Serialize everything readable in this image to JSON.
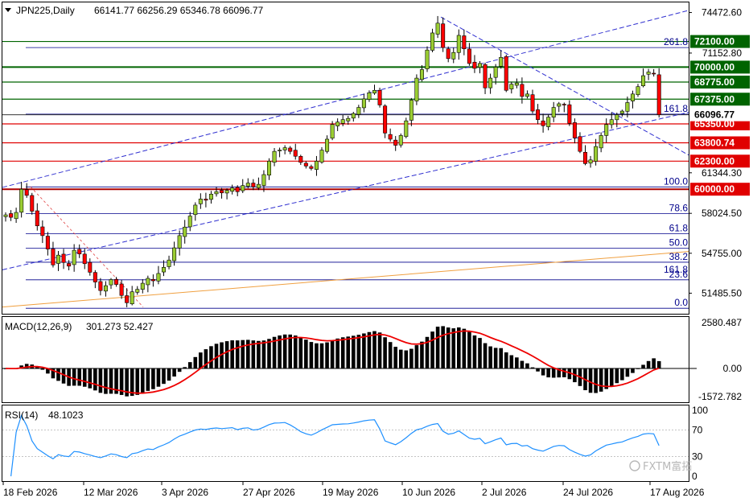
{
  "header": {
    "symbol": "JPN225,Daily",
    "ohlc": "66141.77 66256.29 65346.78 66096.77"
  },
  "watermark": "FXTM富拓",
  "chart_data": [
    {
      "type": "candlestick",
      "title": "JPN225,Daily",
      "ohlc_last": {
        "open": 66141.77,
        "high": 66256.29,
        "low": 65346.78,
        "close": 66096.77
      },
      "y_ticks": [
        "74472.60",
        "71152.80",
        "61344.30",
        "58024.50",
        "54755.00",
        "51485.50"
      ],
      "x_ticks": [
        "18 Feb 2026",
        "12 Mar 2026",
        "3 Apr 2026",
        "27 Apr 2026",
        "19 May 2026",
        "10 Jun 2026",
        "2 Jul 2026",
        "24 Jul 2026",
        "17 Aug 2026"
      ],
      "ylim": [
        49800,
        75300
      ],
      "price_levels_green": [
        72100.0,
        70000.0,
        68775.0,
        67375.0
      ],
      "price_levels_red": [
        65350.0,
        63800.74,
        62300.0,
        60000.0
      ],
      "current_price": 66096.77,
      "green_labels": [
        "72100.00",
        "70000.00",
        "68775.00",
        "67375.00"
      ],
      "red_labels": [
        "65350.00",
        "63800.74",
        "62300.00",
        "60000.00"
      ],
      "current_label": "66096.77",
      "fibonacci": [
        {
          "label": "0.0",
          "level": 50250
        },
        {
          "label": "23.6",
          "level": 52580
        },
        {
          "label": "38.2",
          "level": 54020
        },
        {
          "label": "50.0",
          "level": 55180
        },
        {
          "label": "61.8",
          "level": 56350
        },
        {
          "label": "78.6",
          "level": 58010
        },
        {
          "label": "100.0",
          "level": 60190
        },
        {
          "label": "161.8",
          "level": 66150
        },
        {
          "label": "261.8",
          "level": 71600
        }
      ],
      "fib_extra_label": "161.8",
      "candles_close": [
        57900,
        57700,
        58100,
        60000,
        59500,
        58200,
        57000,
        56200,
        55100,
        53800,
        54600,
        54000,
        53700,
        55000,
        54700,
        53900,
        53200,
        52400,
        51700,
        52100,
        52600,
        52200,
        51300,
        50700,
        51600,
        51800,
        52300,
        52700,
        52500,
        53100,
        53600,
        54200,
        55200,
        56200,
        56900,
        57800,
        58700,
        59200,
        59100,
        59600,
        59800,
        59700,
        59900,
        60100,
        59800,
        60300,
        60500,
        60200,
        60400,
        61200,
        62300,
        63100,
        63200,
        63400,
        63100,
        62700,
        62200,
        61900,
        61700,
        62300,
        63200,
        64100,
        65300,
        65500,
        65700,
        65800,
        66200,
        66700,
        67400,
        67900,
        68100,
        66900,
        64600,
        64100,
        63600,
        64400,
        65600,
        67300,
        69100,
        69800,
        71400,
        72800,
        73600,
        71600,
        70700,
        71200,
        72600,
        71500,
        70300,
        69900,
        70300,
        68300,
        69100,
        70000,
        70800,
        68100,
        68600,
        68700,
        67600,
        67800,
        66400,
        65700,
        65200,
        65900,
        66700,
        67000,
        66900,
        65400,
        64200,
        63100,
        62100,
        62400,
        63500,
        64400,
        65300,
        65700,
        66100,
        66400,
        67100,
        67800,
        68400,
        69300,
        69600,
        69500,
        66100
      ],
      "macd": {
        "label": "MACD(12,26,9)",
        "values": "301.273 52.427",
        "y_ticks": [
          "2580.487",
          "0.00",
          "-1572.782"
        ],
        "ylim": [
          -1900,
          2900
        ]
      },
      "rsi": {
        "label": "RSI(14)",
        "value": "48.1023",
        "y_ticks": [
          "100",
          "70",
          "30",
          "0"
        ],
        "levels": [
          70,
          30
        ],
        "ylim": [
          0,
          100
        ]
      }
    }
  ]
}
